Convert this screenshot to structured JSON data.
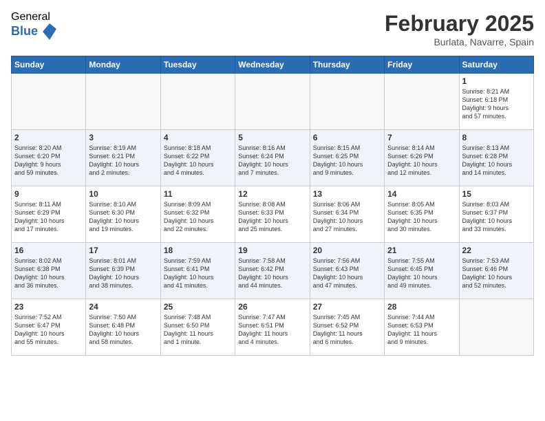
{
  "logo": {
    "general": "General",
    "blue": "Blue"
  },
  "header": {
    "month": "February 2025",
    "location": "Burlata, Navarre, Spain"
  },
  "weekdays": [
    "Sunday",
    "Monday",
    "Tuesday",
    "Wednesday",
    "Thursday",
    "Friday",
    "Saturday"
  ],
  "weeks": [
    [
      {
        "day": "",
        "info": ""
      },
      {
        "day": "",
        "info": ""
      },
      {
        "day": "",
        "info": ""
      },
      {
        "day": "",
        "info": ""
      },
      {
        "day": "",
        "info": ""
      },
      {
        "day": "",
        "info": ""
      },
      {
        "day": "1",
        "info": "Sunrise: 8:21 AM\nSunset: 6:18 PM\nDaylight: 9 hours\nand 57 minutes."
      }
    ],
    [
      {
        "day": "2",
        "info": "Sunrise: 8:20 AM\nSunset: 6:20 PM\nDaylight: 9 hours\nand 59 minutes."
      },
      {
        "day": "3",
        "info": "Sunrise: 8:19 AM\nSunset: 6:21 PM\nDaylight: 10 hours\nand 2 minutes."
      },
      {
        "day": "4",
        "info": "Sunrise: 8:18 AM\nSunset: 6:22 PM\nDaylight: 10 hours\nand 4 minutes."
      },
      {
        "day": "5",
        "info": "Sunrise: 8:16 AM\nSunset: 6:24 PM\nDaylight: 10 hours\nand 7 minutes."
      },
      {
        "day": "6",
        "info": "Sunrise: 8:15 AM\nSunset: 6:25 PM\nDaylight: 10 hours\nand 9 minutes."
      },
      {
        "day": "7",
        "info": "Sunrise: 8:14 AM\nSunset: 6:26 PM\nDaylight: 10 hours\nand 12 minutes."
      },
      {
        "day": "8",
        "info": "Sunrise: 8:13 AM\nSunset: 6:28 PM\nDaylight: 10 hours\nand 14 minutes."
      }
    ],
    [
      {
        "day": "9",
        "info": "Sunrise: 8:11 AM\nSunset: 6:29 PM\nDaylight: 10 hours\nand 17 minutes."
      },
      {
        "day": "10",
        "info": "Sunrise: 8:10 AM\nSunset: 6:30 PM\nDaylight: 10 hours\nand 19 minutes."
      },
      {
        "day": "11",
        "info": "Sunrise: 8:09 AM\nSunset: 6:32 PM\nDaylight: 10 hours\nand 22 minutes."
      },
      {
        "day": "12",
        "info": "Sunrise: 8:08 AM\nSunset: 6:33 PM\nDaylight: 10 hours\nand 25 minutes."
      },
      {
        "day": "13",
        "info": "Sunrise: 8:06 AM\nSunset: 6:34 PM\nDaylight: 10 hours\nand 27 minutes."
      },
      {
        "day": "14",
        "info": "Sunrise: 8:05 AM\nSunset: 6:35 PM\nDaylight: 10 hours\nand 30 minutes."
      },
      {
        "day": "15",
        "info": "Sunrise: 8:03 AM\nSunset: 6:37 PM\nDaylight: 10 hours\nand 33 minutes."
      }
    ],
    [
      {
        "day": "16",
        "info": "Sunrise: 8:02 AM\nSunset: 6:38 PM\nDaylight: 10 hours\nand 36 minutes."
      },
      {
        "day": "17",
        "info": "Sunrise: 8:01 AM\nSunset: 6:39 PM\nDaylight: 10 hours\nand 38 minutes."
      },
      {
        "day": "18",
        "info": "Sunrise: 7:59 AM\nSunset: 6:41 PM\nDaylight: 10 hours\nand 41 minutes."
      },
      {
        "day": "19",
        "info": "Sunrise: 7:58 AM\nSunset: 6:42 PM\nDaylight: 10 hours\nand 44 minutes."
      },
      {
        "day": "20",
        "info": "Sunrise: 7:56 AM\nSunset: 6:43 PM\nDaylight: 10 hours\nand 47 minutes."
      },
      {
        "day": "21",
        "info": "Sunrise: 7:55 AM\nSunset: 6:45 PM\nDaylight: 10 hours\nand 49 minutes."
      },
      {
        "day": "22",
        "info": "Sunrise: 7:53 AM\nSunset: 6:46 PM\nDaylight: 10 hours\nand 52 minutes."
      }
    ],
    [
      {
        "day": "23",
        "info": "Sunrise: 7:52 AM\nSunset: 6:47 PM\nDaylight: 10 hours\nand 55 minutes."
      },
      {
        "day": "24",
        "info": "Sunrise: 7:50 AM\nSunset: 6:48 PM\nDaylight: 10 hours\nand 58 minutes."
      },
      {
        "day": "25",
        "info": "Sunrise: 7:48 AM\nSunset: 6:50 PM\nDaylight: 11 hours\nand 1 minute."
      },
      {
        "day": "26",
        "info": "Sunrise: 7:47 AM\nSunset: 6:51 PM\nDaylight: 11 hours\nand 4 minutes."
      },
      {
        "day": "27",
        "info": "Sunrise: 7:45 AM\nSunset: 6:52 PM\nDaylight: 11 hours\nand 6 minutes."
      },
      {
        "day": "28",
        "info": "Sunrise: 7:44 AM\nSunset: 6:53 PM\nDaylight: 11 hours\nand 9 minutes."
      },
      {
        "day": "",
        "info": ""
      }
    ]
  ]
}
